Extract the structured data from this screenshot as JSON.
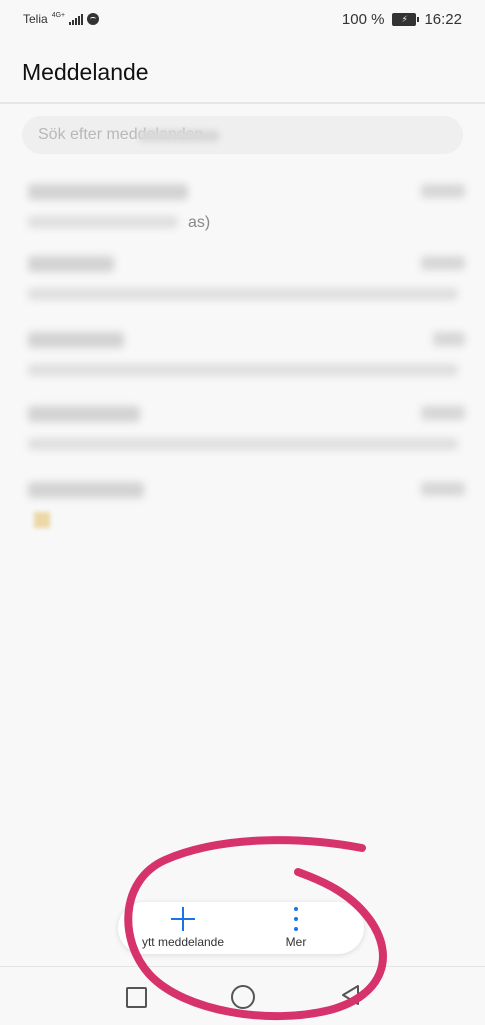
{
  "status_bar": {
    "carrier": "Telia",
    "network": "4G+",
    "battery_percent": "100 %",
    "time": "16:22"
  },
  "header": {
    "title": "Meddelande"
  },
  "search": {
    "placeholder": "Sök efter meddelanden"
  },
  "conversations": [
    {
      "name": "[redacted]",
      "snippet": "as)"
    },
    {
      "name": "[redacted]",
      "snippet": ""
    },
    {
      "name": "[redacted]",
      "snippet": ""
    },
    {
      "name": "[redacted]",
      "snippet": ""
    },
    {
      "name": "[redacted]",
      "snippet": ""
    }
  ],
  "actions": {
    "new_message_label": "ytt meddelande",
    "more_label": "Mer"
  },
  "colors": {
    "accent": "#1a73e8",
    "annotation": "#d6336c"
  },
  "icons": {
    "new_message": "plus-icon",
    "more": "more-vertical-icon"
  }
}
